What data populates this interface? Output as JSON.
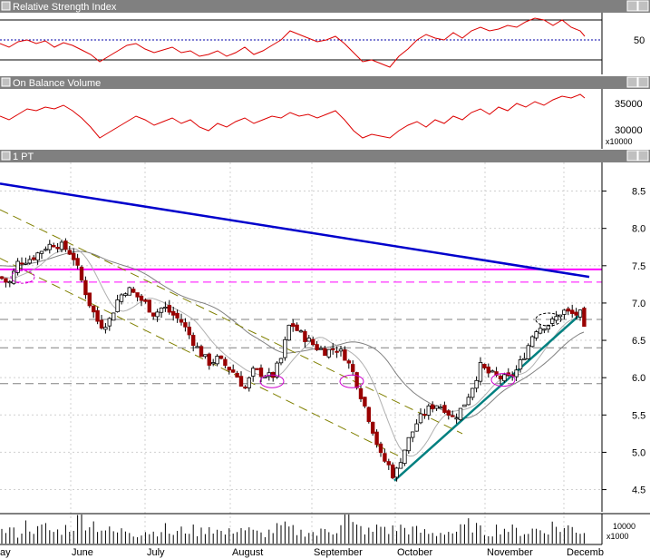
{
  "panels": {
    "rsi": {
      "title": "Relative Strength Index",
      "level_label": "50"
    },
    "obv": {
      "title": "On Balance Volume",
      "labels": [
        "35000",
        "30000"
      ],
      "multiplier": "x10000"
    },
    "price": {
      "title": "1 PT"
    },
    "volume": {
      "label": "10000",
      "multiplier": "x1000"
    }
  },
  "chart_data": {
    "type": "candlestick",
    "y_ticks": [
      "8.5",
      "8.0",
      "7.5",
      "7.0",
      "6.5",
      "6.0",
      "5.5",
      "5.0",
      "4.5"
    ],
    "ylim": [
      4.3,
      8.75
    ],
    "x_labels": [
      "ay",
      "June",
      "July",
      "August",
      "September",
      "October",
      "November",
      "Decemb"
    ],
    "price_path": [
      [
        0,
        7.35
      ],
      [
        10,
        7.25
      ],
      [
        20,
        7.55
      ],
      [
        35,
        7.6
      ],
      [
        50,
        7.75
      ],
      [
        60,
        7.8
      ],
      [
        70,
        7.75
      ],
      [
        80,
        7.65
      ],
      [
        90,
        7.3
      ],
      [
        100,
        6.95
      ],
      [
        110,
        6.7
      ],
      [
        120,
        6.75
      ],
      [
        130,
        7.05
      ],
      [
        140,
        7.2
      ],
      [
        150,
        7.1
      ],
      [
        160,
        7.0
      ],
      [
        170,
        6.85
      ],
      [
        180,
        6.95
      ],
      [
        190,
        6.85
      ],
      [
        200,
        6.75
      ],
      [
        210,
        6.55
      ],
      [
        220,
        6.35
      ],
      [
        230,
        6.2
      ],
      [
        240,
        6.25
      ],
      [
        250,
        6.15
      ],
      [
        260,
        6.05
      ],
      [
        270,
        5.85
      ],
      [
        280,
        6.1
      ],
      [
        290,
        6.05
      ],
      [
        300,
        6.0
      ],
      [
        310,
        6.25
      ],
      [
        320,
        6.75
      ],
      [
        330,
        6.6
      ],
      [
        340,
        6.5
      ],
      [
        350,
        6.4
      ],
      [
        360,
        6.35
      ],
      [
        370,
        6.4
      ],
      [
        380,
        6.3
      ],
      [
        390,
        6.05
      ],
      [
        400,
        5.7
      ],
      [
        410,
        5.35
      ],
      [
        420,
        4.95
      ],
      [
        430,
        4.8
      ],
      [
        435,
        4.65
      ],
      [
        440,
        4.85
      ],
      [
        450,
        5.15
      ],
      [
        460,
        5.4
      ],
      [
        470,
        5.55
      ],
      [
        480,
        5.65
      ],
      [
        490,
        5.6
      ],
      [
        500,
        5.45
      ],
      [
        510,
        5.6
      ],
      [
        520,
        5.85
      ],
      [
        530,
        6.15
      ],
      [
        540,
        6.05
      ],
      [
        550,
        6.0
      ],
      [
        560,
        5.98
      ],
      [
        570,
        6.1
      ],
      [
        580,
        6.35
      ],
      [
        590,
        6.65
      ],
      [
        600,
        6.7
      ],
      [
        610,
        6.75
      ],
      [
        620,
        6.9
      ],
      [
        630,
        6.85
      ],
      [
        640,
        6.85
      ],
      [
        645,
        6.6
      ]
    ],
    "volume_path": [
      [
        0,
        6
      ],
      [
        10,
        8
      ],
      [
        20,
        5
      ],
      [
        30,
        11
      ],
      [
        40,
        7
      ],
      [
        50,
        9
      ],
      [
        60,
        6
      ],
      [
        70,
        8
      ],
      [
        80,
        10
      ],
      [
        90,
        14
      ],
      [
        100,
        12
      ],
      [
        110,
        9
      ],
      [
        120,
        7
      ],
      [
        130,
        6
      ],
      [
        140,
        8
      ],
      [
        150,
        5
      ],
      [
        160,
        7
      ],
      [
        170,
        6
      ],
      [
        180,
        9
      ],
      [
        190,
        5
      ],
      [
        200,
        7
      ],
      [
        210,
        8
      ],
      [
        220,
        6
      ],
      [
        230,
        10
      ],
      [
        240,
        7
      ],
      [
        250,
        5
      ],
      [
        260,
        9
      ],
      [
        270,
        8
      ],
      [
        280,
        6
      ],
      [
        290,
        5
      ],
      [
        300,
        7
      ],
      [
        310,
        9
      ],
      [
        320,
        8
      ],
      [
        330,
        6
      ],
      [
        340,
        7
      ],
      [
        350,
        5
      ],
      [
        360,
        8
      ],
      [
        370,
        7
      ],
      [
        380,
        16
      ],
      [
        390,
        9
      ],
      [
        400,
        8
      ],
      [
        410,
        6
      ],
      [
        420,
        10
      ],
      [
        430,
        7
      ],
      [
        440,
        9
      ],
      [
        450,
        8
      ],
      [
        460,
        7
      ],
      [
        470,
        6
      ],
      [
        480,
        5
      ],
      [
        490,
        7
      ],
      [
        500,
        6
      ],
      [
        510,
        8
      ],
      [
        520,
        11
      ],
      [
        530,
        7
      ],
      [
        540,
        6
      ],
      [
        550,
        9
      ],
      [
        560,
        8
      ],
      [
        570,
        7
      ],
      [
        580,
        6
      ],
      [
        590,
        8
      ],
      [
        600,
        7
      ],
      [
        610,
        10
      ],
      [
        620,
        8
      ],
      [
        630,
        9
      ],
      [
        640,
        7
      ],
      [
        650,
        6
      ]
    ],
    "horizontal_lines": [
      {
        "value": 7.45,
        "style": "solid",
        "color": "#ff00ff"
      },
      {
        "value": 7.28,
        "style": "dashed",
        "color": "#ff00ff"
      },
      {
        "value": 6.78,
        "style": "dashed",
        "color": "#808080"
      },
      {
        "value": 6.4,
        "style": "dashed",
        "color": "#808080"
      },
      {
        "value": 5.92,
        "style": "dashed",
        "color": "#808080"
      }
    ],
    "trendlines": [
      {
        "name": "resistance",
        "color": "#0000cc",
        "from": [
          0,
          8.6
        ],
        "to": [
          650,
          7.35
        ]
      },
      {
        "name": "uptrend",
        "color": "#008080",
        "from": [
          435,
          4.62
        ],
        "to": [
          645,
          6.9
        ]
      },
      {
        "name": "channel-upper",
        "color": "#808000",
        "from": [
          0,
          8.25
        ],
        "to": [
          510,
          5.25
        ]
      },
      {
        "name": "channel-lower",
        "color": "#808000",
        "from": [
          0,
          7.6
        ],
        "to": [
          440,
          4.95
        ]
      }
    ],
    "circles": [
      [
        25,
        7.35
      ],
      [
        300,
        5.95
      ],
      [
        388,
        5.95
      ],
      [
        555,
        5.97
      ],
      [
        605,
        6.78
      ]
    ],
    "colors": {
      "title_bar": "#808080",
      "rsi_line": "#dd0000",
      "bull": "#ffffff",
      "bear": "#990000",
      "ma_long": "#808080",
      "ma_short": "#b0b0b0"
    }
  }
}
